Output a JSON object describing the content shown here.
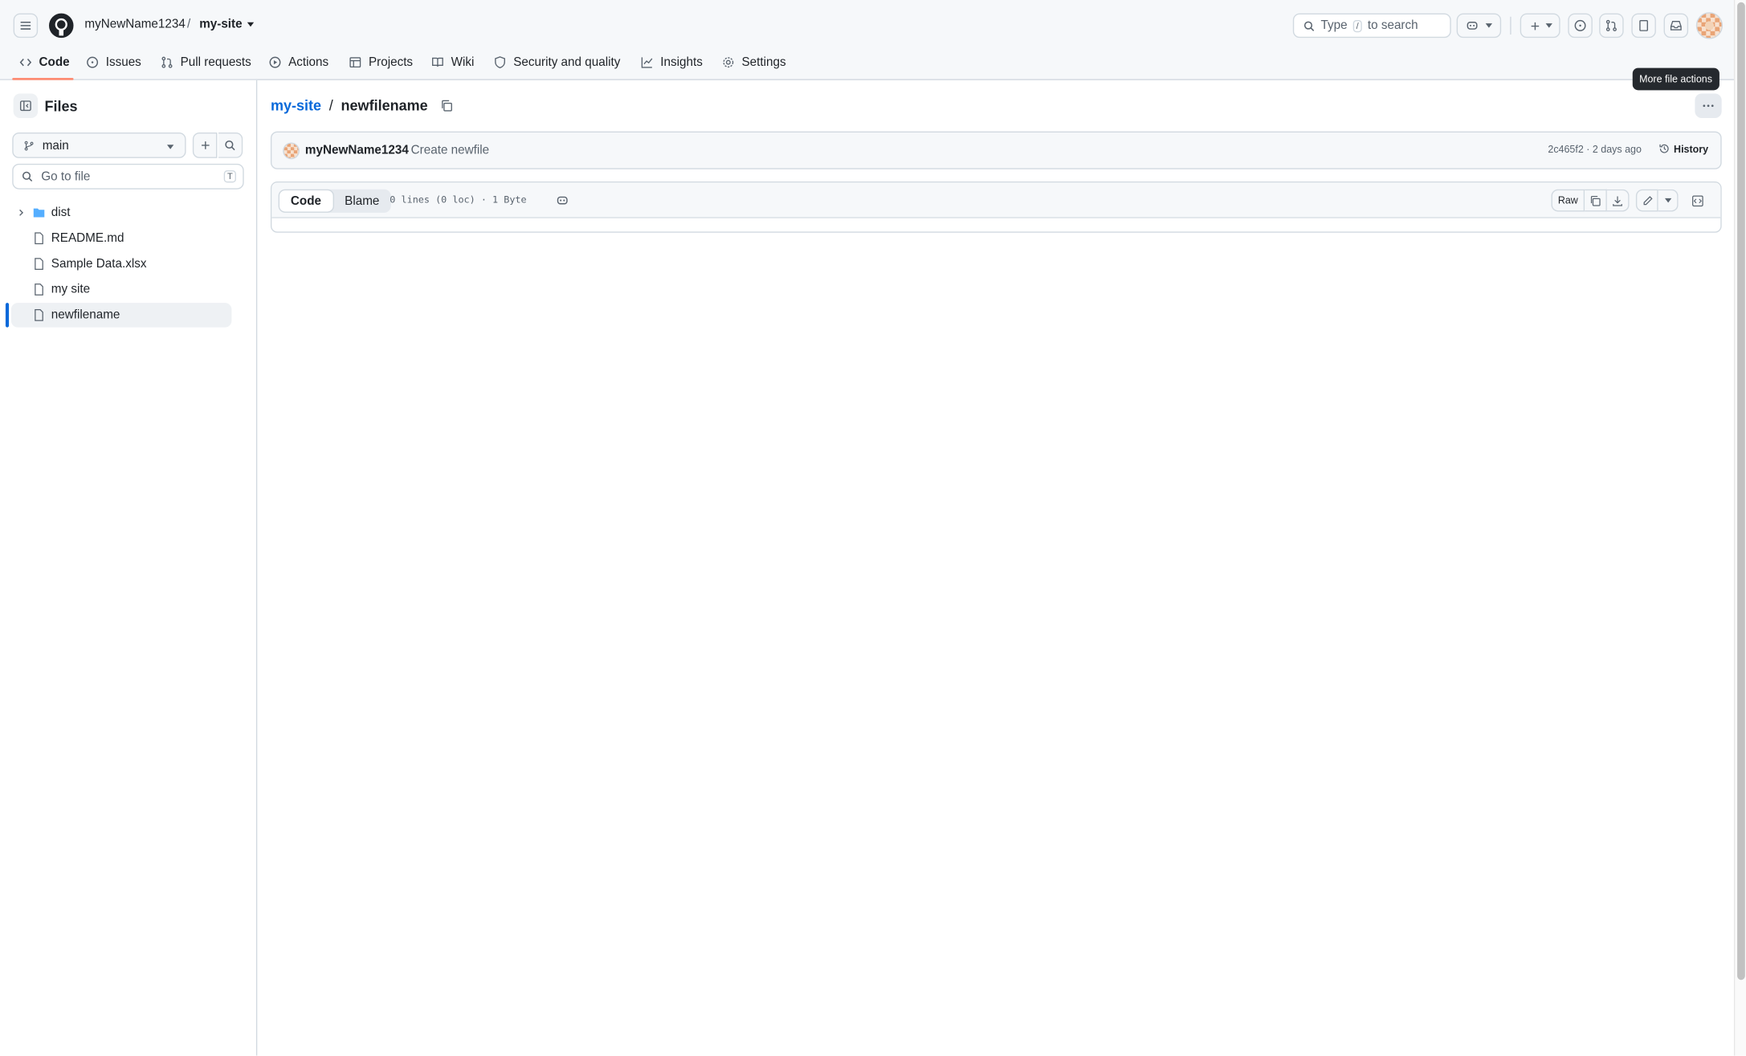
{
  "header": {
    "owner": "myNewName1234",
    "separator": "/",
    "repo": "my-site",
    "search_placeholder_prefix": "Type",
    "search_key": "/",
    "search_placeholder_suffix": "to search"
  },
  "nav": {
    "tabs": [
      {
        "label": "Code",
        "icon": "code-icon",
        "active": true
      },
      {
        "label": "Issues",
        "icon": "issue-icon"
      },
      {
        "label": "Pull requests",
        "icon": "pull-request-icon"
      },
      {
        "label": "Actions",
        "icon": "play-icon"
      },
      {
        "label": "Projects",
        "icon": "table-icon"
      },
      {
        "label": "Wiki",
        "icon": "book-icon"
      },
      {
        "label": "Security and quality",
        "icon": "shield-icon"
      },
      {
        "label": "Insights",
        "icon": "graph-icon"
      },
      {
        "label": "Settings",
        "icon": "gear-icon"
      }
    ]
  },
  "sidebar": {
    "title": "Files",
    "branch": "main",
    "go_to_file": "Go to file",
    "go_to_file_key": "T",
    "tree": [
      {
        "name": "dist",
        "type": "folder"
      },
      {
        "name": "README.md",
        "type": "file"
      },
      {
        "name": "Sample Data.xlsx",
        "type": "file"
      },
      {
        "name": "my site",
        "type": "file"
      },
      {
        "name": "newfilename",
        "type": "file",
        "selected": true
      }
    ]
  },
  "main": {
    "breadcrumb_repo": "my-site",
    "breadcrumb_sep": "/",
    "breadcrumb_file": "newfilename",
    "tooltip": "More file actions",
    "commit": {
      "author": "myNewName1234",
      "message": "Create newfile",
      "sha_time": "2c465f2 · 2 days ago",
      "history_label": "History"
    },
    "file": {
      "view_code": "Code",
      "view_blame": "Blame",
      "meta": "0 lines (0 loc) · 1 Byte",
      "raw_label": "Raw"
    }
  },
  "colors": {
    "accent": "#0969da",
    "active_underline": "#fd8c73"
  }
}
